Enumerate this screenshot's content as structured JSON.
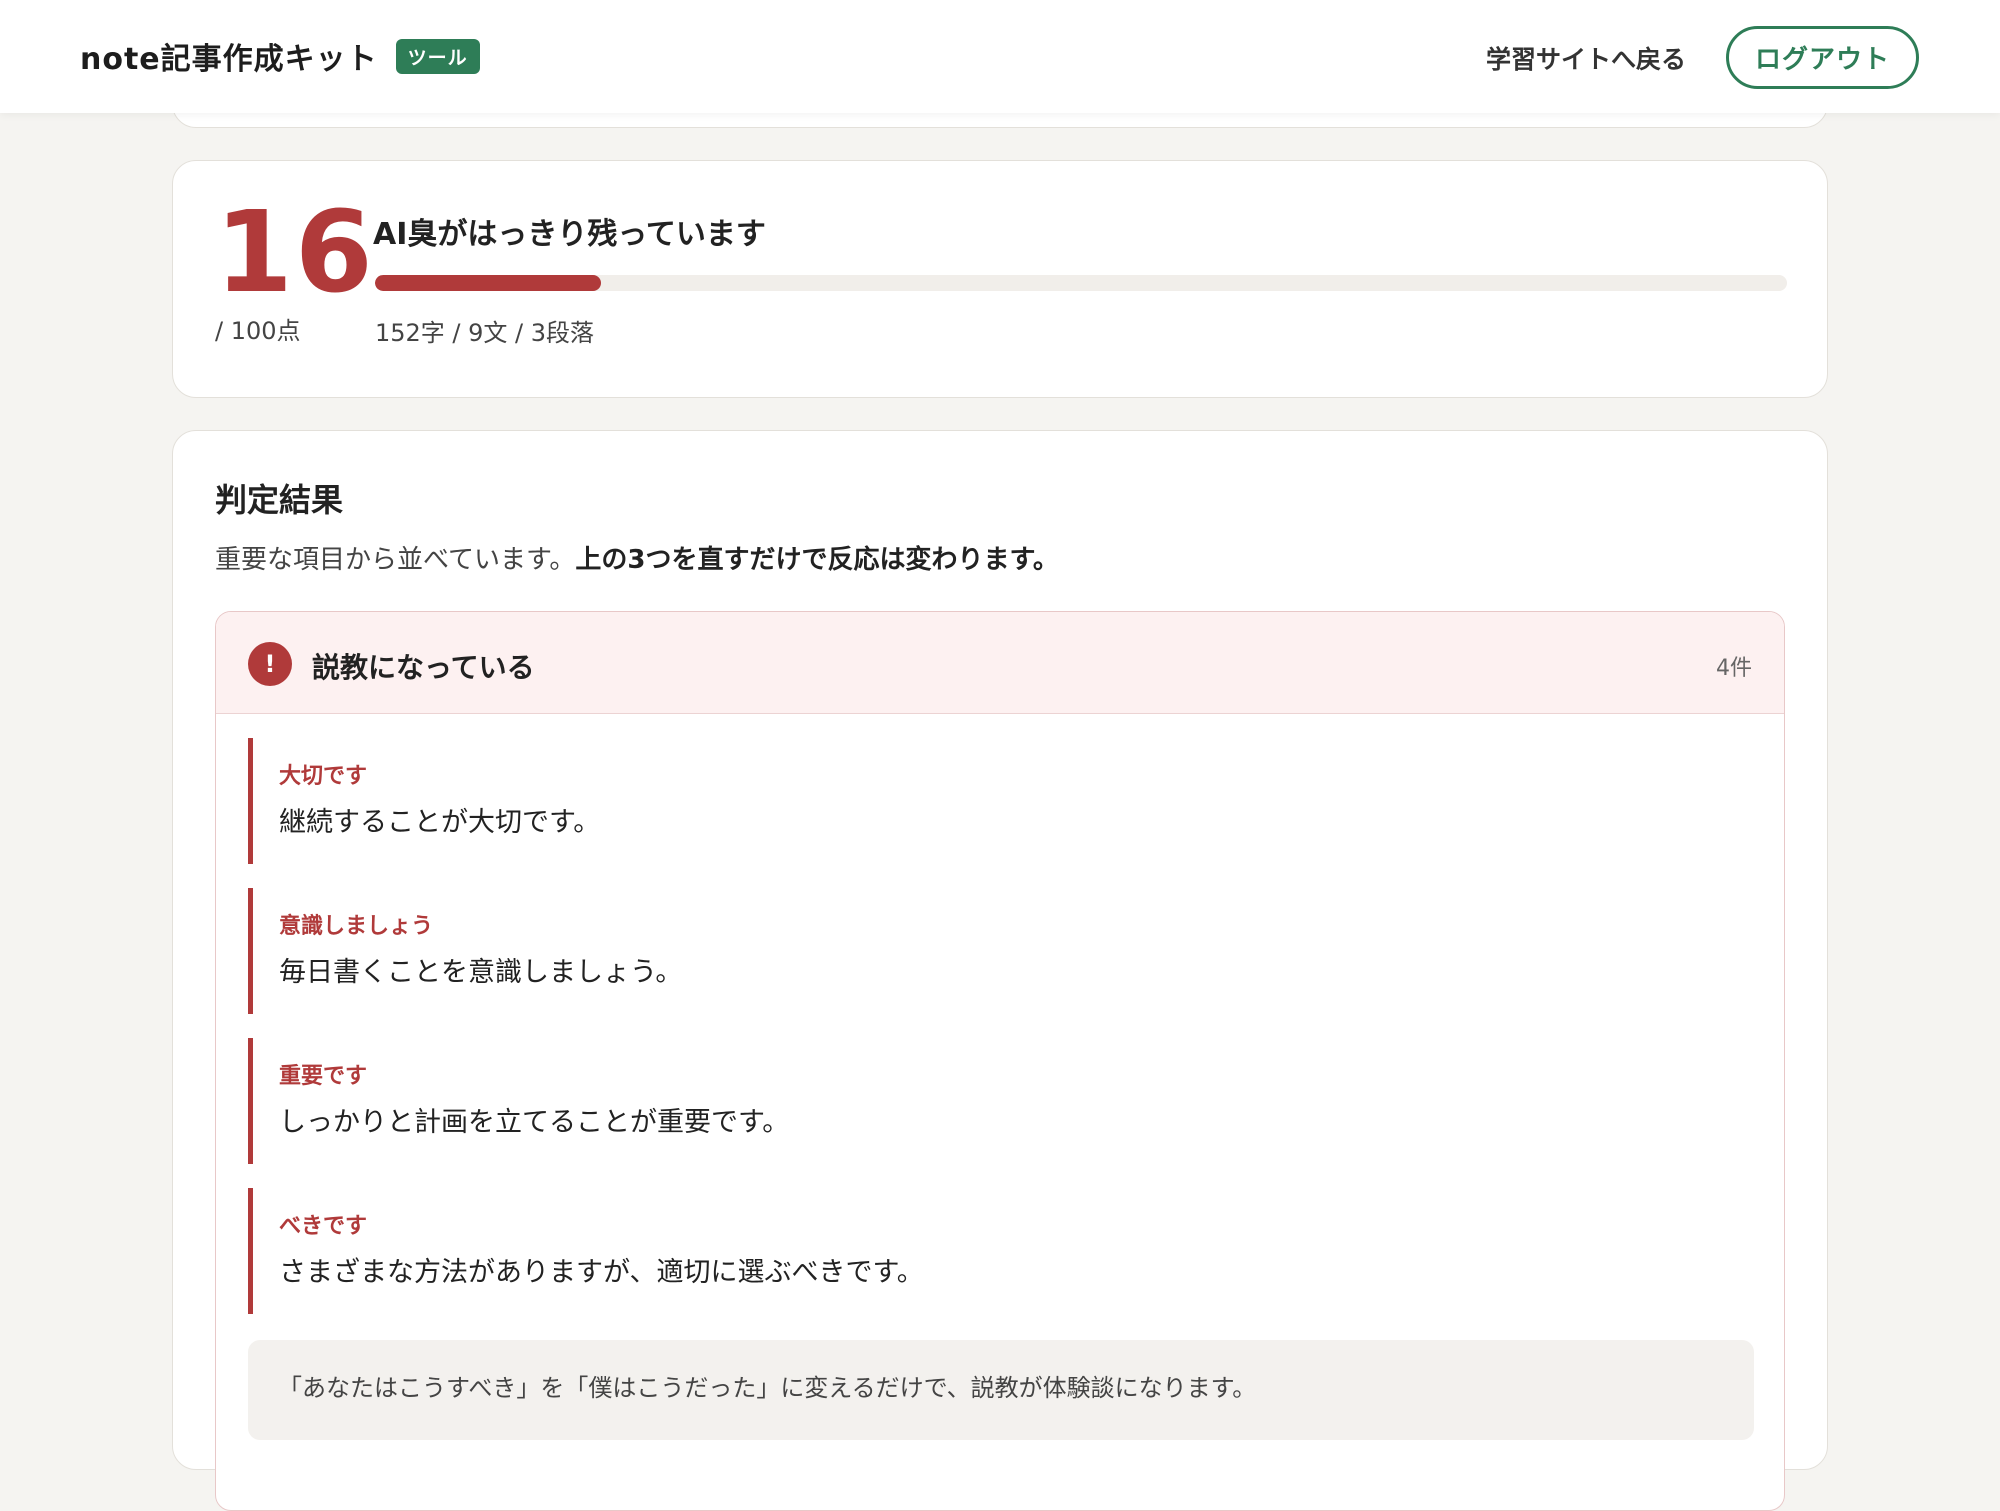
{
  "header": {
    "title": "note記事作成キット",
    "badge": "ツール",
    "back_link": "学習サイトへ戻る",
    "logout_label": "ログアウト"
  },
  "score": {
    "value": "16",
    "max_label": "/ 100点",
    "verdict": "AI臭がはっきり残っています",
    "progress": 0.16,
    "stats": "152字 / 9文 / 3段落"
  },
  "results": {
    "title": "判定結果",
    "description_plain": "重要な項目から並べています。",
    "description_bold": "上の3つを直すだけで反応は変わります。",
    "groups": [
      {
        "icon": "exclamation-icon",
        "title": "説教になっている",
        "count": "4件",
        "items": [
          {
            "label": "大切です",
            "text": "継続することが大切です。"
          },
          {
            "label": "意識しましょう",
            "text": "毎日書くことを意識しましょう。"
          },
          {
            "label": "重要です",
            "text": "しっかりと計画を立てることが重要です。"
          },
          {
            "label": "べきです",
            "text": "さまざまな方法がありますが、適切に選ぶべきです。"
          }
        ],
        "tip": "「あなたはこうすべき」を「僕はこうだった」に変えるだけで、説教が体験談になります。"
      }
    ]
  },
  "colors": {
    "accent_green": "#2e7d57",
    "alert_red": "#b03a3a",
    "background": "#f5f4f1"
  }
}
